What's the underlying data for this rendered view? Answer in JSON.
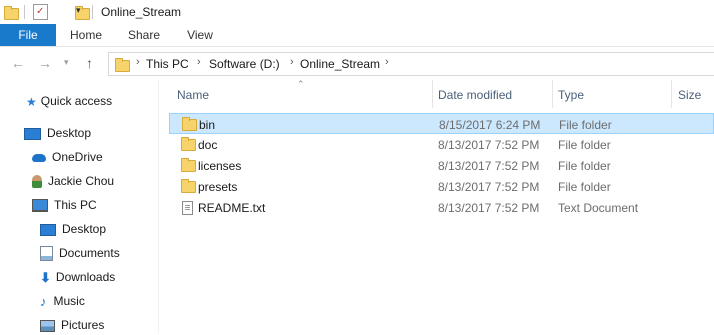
{
  "window": {
    "title": "Online_Stream"
  },
  "ribbon": {
    "tabs": [
      "File",
      "Home",
      "Share",
      "View"
    ]
  },
  "address": {
    "crumbs": [
      "This PC",
      "Software (D:)",
      "Online_Stream"
    ]
  },
  "navpane": {
    "items": [
      {
        "label": "Quick access",
        "icon": "star-icon"
      },
      {
        "label": "Desktop",
        "icon": "desktop-icon"
      },
      {
        "label": "OneDrive",
        "icon": "cloud-icon"
      },
      {
        "label": "Jackie Chou",
        "icon": "user-icon"
      },
      {
        "label": "This PC",
        "icon": "computer-icon"
      },
      {
        "label": "Desktop",
        "icon": "desktop-icon"
      },
      {
        "label": "Documents",
        "icon": "documents-icon"
      },
      {
        "label": "Downloads",
        "icon": "download-icon"
      },
      {
        "label": "Music",
        "icon": "music-icon"
      },
      {
        "label": "Pictures",
        "icon": "pictures-icon"
      }
    ]
  },
  "columns": {
    "name": "Name",
    "date": "Date modified",
    "type": "Type",
    "size": "Size"
  },
  "files": [
    {
      "name": "bin",
      "date": "8/15/2017 6:24 PM",
      "type": "File folder",
      "icon": "folder-icon",
      "selected": true
    },
    {
      "name": "doc",
      "date": "8/13/2017 7:52 PM",
      "type": "File folder",
      "icon": "folder-icon"
    },
    {
      "name": "licenses",
      "date": "8/13/2017 7:52 PM",
      "type": "File folder",
      "icon": "folder-icon"
    },
    {
      "name": "presets",
      "date": "8/13/2017 7:52 PM",
      "type": "File folder",
      "icon": "folder-icon"
    },
    {
      "name": "README.txt",
      "date": "8/13/2017 7:52 PM",
      "type": "Text Document",
      "icon": "text-file-icon"
    }
  ],
  "colors": {
    "accent": "#1979ca",
    "selection": "#cce8ff",
    "folder": "#f6d36b"
  }
}
